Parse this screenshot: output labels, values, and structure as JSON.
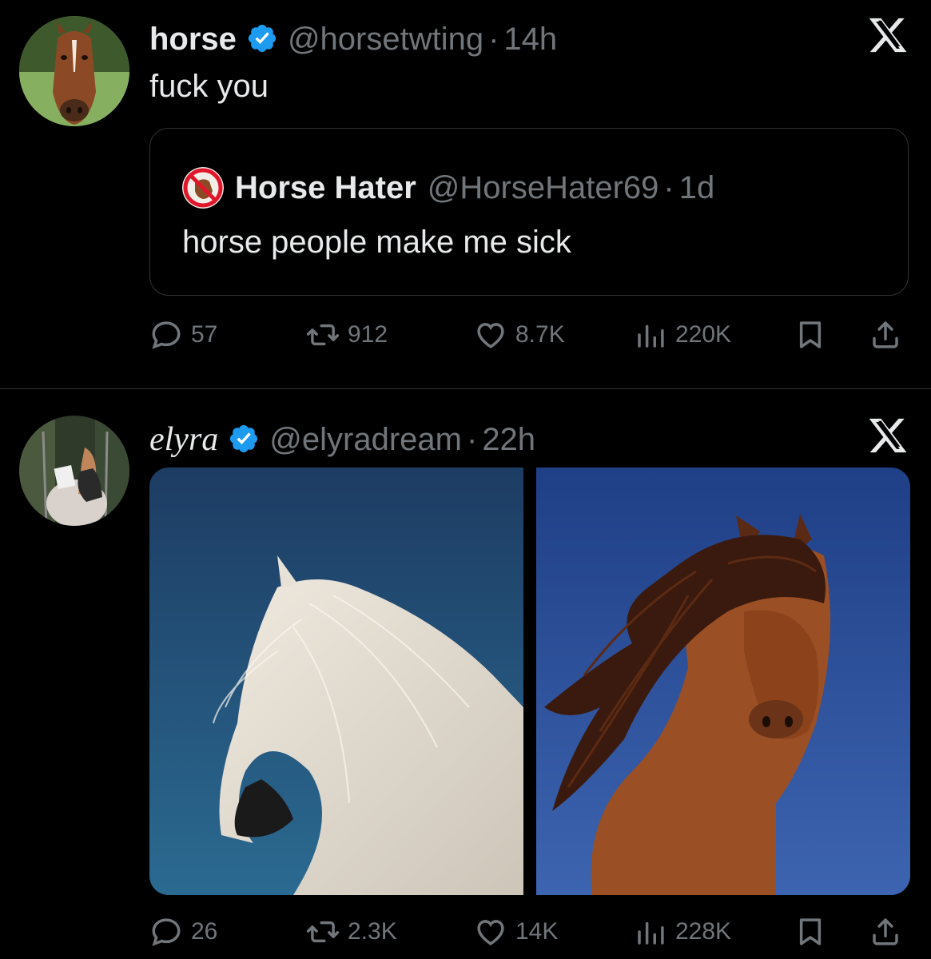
{
  "tweets": [
    {
      "name": "horse",
      "handle": "@horsetwting",
      "sep": "·",
      "time": "14h",
      "text": "fuck you",
      "quote": {
        "name": "Horse Hater",
        "handle": "@HorseHater69",
        "sep": "·",
        "time": "1d",
        "text": "horse people make me sick"
      },
      "stats": {
        "replies": "57",
        "reposts": "912",
        "likes": "8.7K",
        "views": "220K"
      }
    },
    {
      "name": "elyra",
      "handle": "@elyradream",
      "sep": "·",
      "time": "22h",
      "stats": {
        "replies": "26",
        "reposts": "2.3K",
        "likes": "14K",
        "views": "228K"
      }
    }
  ],
  "colors": {
    "background": "#000000",
    "text": "#e7e9ea",
    "muted": "#71767b",
    "verified": "#1d9bf0",
    "border": "#2f3336"
  },
  "icons": [
    "verified-badge-icon",
    "x-logo-icon",
    "reply-icon",
    "repost-icon",
    "like-icon",
    "views-icon",
    "bookmark-icon",
    "share-icon"
  ]
}
